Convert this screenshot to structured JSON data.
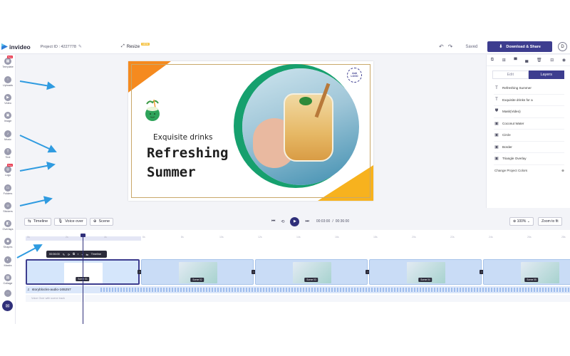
{
  "topbar": {
    "logo_text": "invideo",
    "project_id": "Project ID : 4227778",
    "resize_label": "Resize",
    "resize_badge": "NEW",
    "saved_label": "Saved",
    "download_label": "Download & Share",
    "avatar_initial": "D"
  },
  "sidebar": {
    "items": [
      {
        "label": "Template",
        "icon": "templates-icon",
        "badge": "New"
      },
      {
        "label": "Uploads",
        "icon": "uploads-icon"
      },
      {
        "label": "Video",
        "icon": "video-icon"
      },
      {
        "label": "Image",
        "icon": "image-icon"
      },
      {
        "label": "Music",
        "icon": "music-icon"
      },
      {
        "label": "Text",
        "icon": "text-icon"
      },
      {
        "label": "Logo",
        "icon": "logo-icon",
        "badge": "New"
      },
      {
        "label": "Folders",
        "icon": "folders-icon"
      },
      {
        "label": "Stickers",
        "icon": "stickers-icon"
      },
      {
        "label": "Overlays",
        "icon": "overlays-icon"
      },
      {
        "label": "Shapes",
        "icon": "shapes-icon"
      },
      {
        "label": "Masks",
        "icon": "masks-icon"
      },
      {
        "label": "Collage",
        "icon": "collage-icon"
      }
    ]
  },
  "canvas": {
    "subtitle": "Exquisite drinks",
    "title_line1": "Refreshing",
    "title_line2": "Summer",
    "logo_badge_line1": "Add",
    "logo_badge_line2": "LOGO",
    "colors": {
      "orange": "#f58a1f",
      "yellow": "#f7b21e",
      "green": "#16a06e",
      "border": "#c9a86a"
    }
  },
  "right_panel": {
    "tabs": [
      "Edit",
      "Layers"
    ],
    "active_tab": "Layers",
    "layers": [
      {
        "label": "Refreshing Summer",
        "icon": "text-icon"
      },
      {
        "label": "Exquisite drinks for a",
        "icon": "text-icon"
      },
      {
        "label": "Mask(Video)",
        "icon": "mask-icon"
      },
      {
        "label": "Coconut Water",
        "icon": "image-icon"
      },
      {
        "label": "Circle",
        "icon": "image-icon"
      },
      {
        "label": "Border",
        "icon": "image-icon"
      },
      {
        "label": "Triangle Overlay",
        "icon": "image-icon"
      }
    ],
    "change_colors_label": "Change Project Colors"
  },
  "controls": {
    "timeline_label": "Timeline",
    "voiceover_label": "Voice over",
    "scene_label": "Scene",
    "current_time": "00:03:00",
    "time_separator": "/",
    "total_time": "00:36:00",
    "zoom_level": "100%",
    "zoom_fit_label": "Zoom to fit"
  },
  "timeline": {
    "ruler_ticks": [
      "0s",
      "2s",
      "4s",
      "6s",
      "8s",
      "10s",
      "12s",
      "14s",
      "16s",
      "18s",
      "20s",
      "22s",
      "24s",
      "26s",
      "28s"
    ],
    "scene_toolbar": {
      "time": "00:06:00",
      "label": "Timeline"
    },
    "scenes": [
      {
        "label": "Scene 01"
      },
      {
        "label": "Scene 02"
      },
      {
        "label": "Scene 03"
      },
      {
        "label": "Scene 04"
      },
      {
        "label": "Scene 05"
      }
    ],
    "audio_label": "storyblocks-audio-165257",
    "voice_placeholder": "Voice Over with scene track"
  }
}
